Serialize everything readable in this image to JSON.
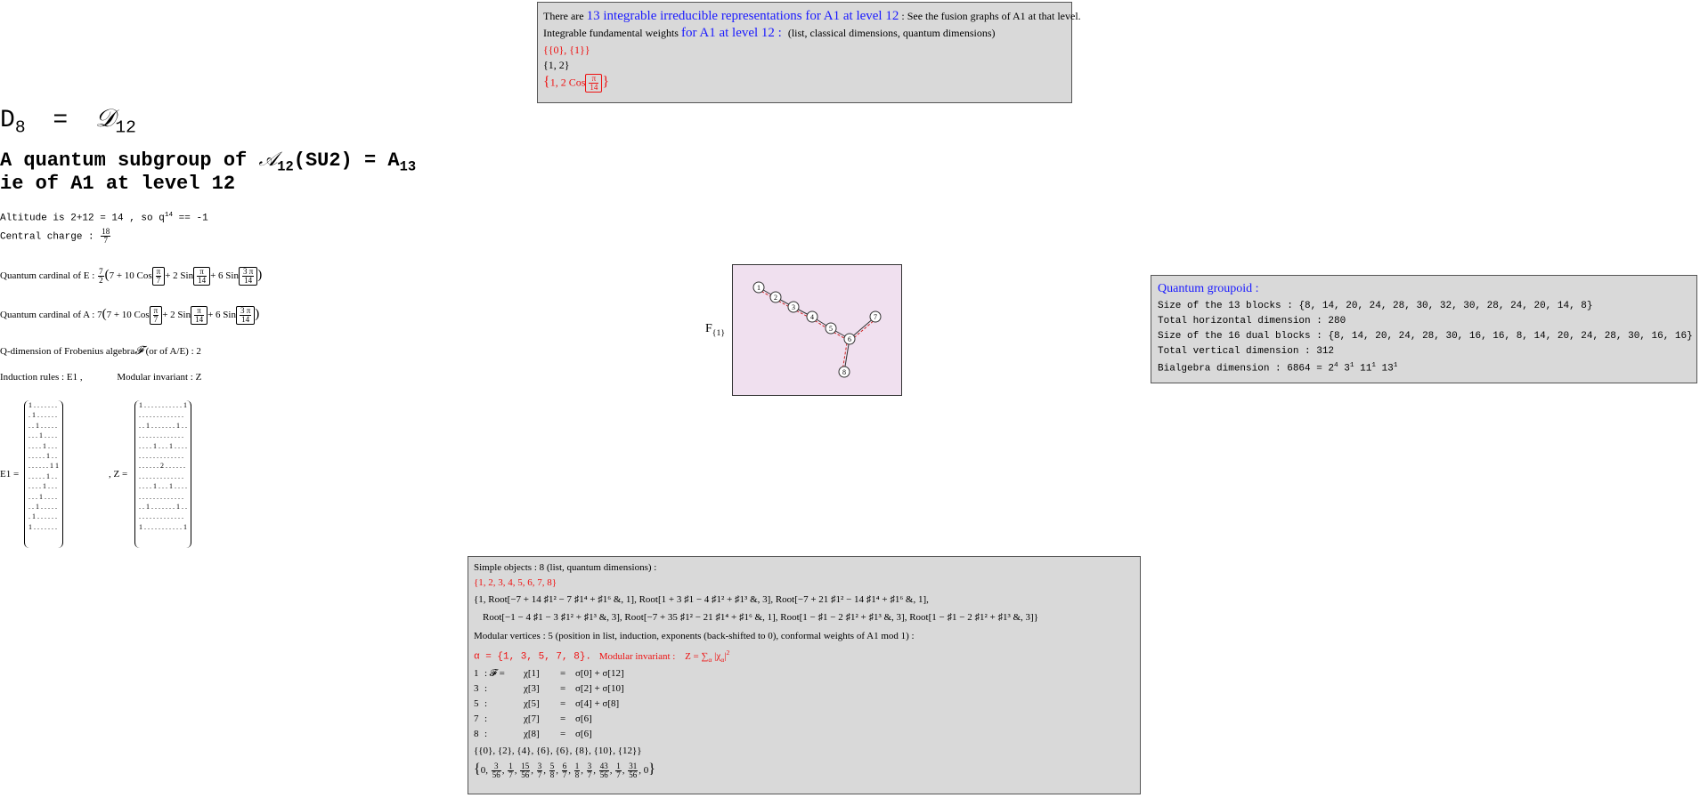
{
  "top_box": {
    "line1_pre": "There are",
    "line1_link": "13 integrable irreducible representations for A1 at level 12",
    "line1_post": ": See the fusion graphs of A1 at that level.",
    "line2_pre": "Integrable fundamental weights",
    "line2_link": "for A1 at level 12 :",
    "line2_post": "(list, classical dimensions, quantum dimensions)",
    "line3": "{{0}, {1}}",
    "line4": "{1, 2}",
    "line5_a": "1, 2 Cos",
    "line5_num": "π",
    "line5_den": "14"
  },
  "heading": {
    "title_left": "D",
    "title_left_sub": "8",
    "title_eq": "=",
    "title_right": "𝒟",
    "title_right_sub": "12",
    "subtitle_pre": "A quantum subgroup of ",
    "subtitle_cal": "𝒜",
    "subtitle_cal_sub": "12",
    "subtitle_mid": "(SU2) = A",
    "subtitle_mid_sub": "13",
    "subtitle2": "ie of A1 at level 12"
  },
  "info": {
    "altitude": "Altitude is 2+12 = 14 , so q",
    "altitude_sup": "14",
    "altitude_end": " == -1",
    "central_label": "Central charge :",
    "central_num": "18",
    "central_den": "7",
    "qcard_e_label": "Quantum cardinal of E :",
    "qcard_e_coef_num": "7",
    "qcard_e_coef_den": "2",
    "qcard_a_label": "Quantum cardinal of A :",
    "qcard_a_coef": "7",
    "qcard_expr_a": "7 + 10 Cos",
    "qcard_expr_b": "+ 2 Sin",
    "qcard_expr_c": "+ 6 Sin",
    "pi": "π",
    "three_pi": "3 π",
    "seven": "7",
    "fourteen": "14",
    "qdim": "Q-dimension of Frobenius algebra",
    "qdim_f": "𝓕",
    "qdim_end": "(or of A/E) : 2",
    "induction": "Induction rules : E1 ,",
    "modular": "Modular invariant : Z",
    "e1_label": "E1 =",
    "z_label": ", Z ="
  },
  "matrices": {
    "e1": [
      "1 . . . . . . .",
      ". 1 . . . . . .",
      ". . 1 . . . . .",
      ". . . 1 . . . .",
      ". . . . 1 . . .",
      ". . . . . 1 . .",
      ". . . . . . 1 1",
      ". . . . . 1 . .",
      ". . . . 1 . . .",
      ". . . 1 . . . .",
      ". . 1 . . . . .",
      ". 1 . . . . . .",
      "1 . . . . . . ."
    ],
    "z": [
      "1 . . . . . . . . . . . 1",
      ". . . . . . . . . . . . .",
      ". . 1 . . . . . . . 1 . .",
      ". . . . . . . . . . . . .",
      ". . . . 1 . . . 1 . . . .",
      ". . . . . . . . . . . . .",
      ". . . . . . 2 . . . . . .",
      ". . . . . . . . . . . . .",
      ". . . . 1 . . . 1 . . . .",
      ". . . . . . . . . . . . .",
      ". . 1 . . . . . . . 1 . .",
      ". . . . . . . . . . . . .",
      "1 . . . . . . . . . . . 1"
    ]
  },
  "graph": {
    "label": "F",
    "label_sub": "{1}",
    "nodes": [
      "1",
      "2",
      "3",
      "4",
      "5",
      "6",
      "7",
      "8"
    ],
    "edge_color": "#cc2222",
    "bg_color": "#f0e0ef"
  },
  "groupoid": {
    "title": "Quantum groupoid :",
    "l1_label": "Size of the 13 blocks :",
    "l1_val": "{8, 14, 20, 24, 28, 30, 32, 30, 28, 24, 20, 14, 8}",
    "l2": "Total horizontal dimension : 280",
    "l3_label": "Size of the 16 dual blocks :",
    "l3_val": "{8, 14, 20, 24, 28, 30, 16, 16, 8, 14, 20, 24, 28, 30, 16, 16}",
    "l4": "Total vertical dimension : 312",
    "l5": "Bialgebra dimension : 6864 = 2",
    "l5_e1": "4",
    "l5_b2": " 3",
    "l5_e2": "1",
    "l5_b3": " 11",
    "l5_e3": "1",
    "l5_b4": " 13",
    "l5_e4": "1"
  },
  "bottom_box": {
    "l1": "Simple objects : 8 (list, quantum dimensions) :",
    "l2": "{1, 2, 3, 4, 5, 6, 7, 8}",
    "l3": "{1, Root[−7 + 14 ♯1² − 7 ♯1⁴ + ♯1⁶ &, 1], Root[1 + 3 ♯1 − 4 ♯1² + ♯1³ &, 3], Root[−7 + 21 ♯1² − 14 ♯1⁴ + ♯1⁶ &, 1],",
    "l4": "Root[−1 − 4 ♯1 − 3 ♯1² + ♯1³ &, 3], Root[−7 + 35 ♯1² − 21 ♯1⁴ + ♯1⁶ &, 1], Root[1 − ♯1 − 2 ♯1² + ♯1³ &, 3], Root[1 − ♯1 − 2 ♯1² + ♯1³ &, 3]}",
    "l5": "Modular vertices : 5 (position in list, induction, exponents (back-shifted to 0), conformal weights of A1 mod 1) :",
    "l6_a": "α = {1, 3, 5, 7, 8}.",
    "l6_b": "Modular invariant :",
    "l6_c": "Z = ∑",
    "l6_c_sub": "α",
    "l6_d": " |χ",
    "l6_d_sub": "α",
    "l6_e": "|",
    "l6_e_sup": "2",
    "rows": [
      {
        "idx": "1",
        "f": ": 𝓕 =",
        "lhs": "χ[1]",
        "eq": "=",
        "rhs": "σ[0] + σ[12]"
      },
      {
        "idx": "3",
        "f": ":",
        "lhs": "χ[3]",
        "eq": "=",
        "rhs": "σ[2] + σ[10]"
      },
      {
        "idx": "5",
        "f": ":",
        "lhs": "χ[5]",
        "eq": "=",
        "rhs": "σ[4] + σ[8]"
      },
      {
        "idx": "7",
        "f": ":",
        "lhs": "χ[7]",
        "eq": "=",
        "rhs": "σ[6]"
      },
      {
        "idx": "8",
        "f": ":",
        "lhs": "χ[8]",
        "eq": "=",
        "rhs": "σ[6]"
      }
    ],
    "l12": "{{0}, {2}, {4}, {6}, {6}, {8}, {10}, {12}}",
    "l13_fracs": [
      [
        "0",
        ""
      ],
      [
        "3",
        "56"
      ],
      [
        "1",
        "7"
      ],
      [
        "15",
        "56"
      ],
      [
        "3",
        "7"
      ],
      [
        "5",
        "8"
      ],
      [
        "6",
        "7"
      ],
      [
        "1",
        "8"
      ],
      [
        "3",
        "7"
      ],
      [
        "43",
        "56"
      ],
      [
        "1",
        "7"
      ],
      [
        "31",
        "56"
      ],
      [
        "0",
        ""
      ]
    ]
  }
}
